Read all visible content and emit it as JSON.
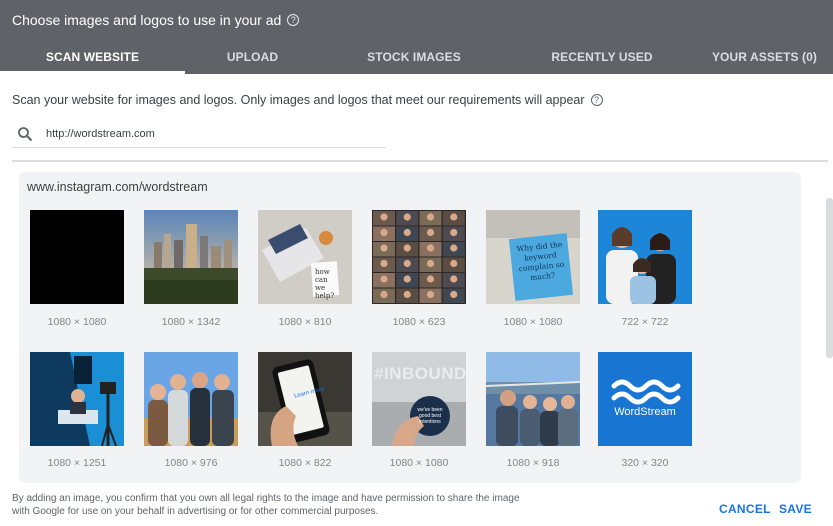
{
  "dialog": {
    "title": "Choose images and logos to use in your ad",
    "help_glyph": "?"
  },
  "tabs": [
    {
      "label": "SCAN WEBSITE",
      "active": true
    },
    {
      "label": "UPLOAD",
      "active": false
    },
    {
      "label": "STOCK IMAGES",
      "active": false
    },
    {
      "label": "RECENTLY USED",
      "active": false
    },
    {
      "label": "YOUR ASSETS (0)",
      "active": false
    }
  ],
  "scan": {
    "description": "Scan your website for images and logos. Only images and logos that meet our requirements will appear",
    "url_value": "http://wordstream.com",
    "search_icon": "search-icon"
  },
  "gallery": {
    "source_label": "www.instagram.com/wordstream",
    "images": [
      {
        "dims": "1080 × 1080",
        "subject": "black-square"
      },
      {
        "dims": "1080 × 1342",
        "subject": "city-skyline"
      },
      {
        "dims": "1080 × 810",
        "subject": "laptop-desk"
      },
      {
        "dims": "1080 × 623",
        "subject": "video-call-grid"
      },
      {
        "dims": "1080 × 1080",
        "subject": "sticky-note"
      },
      {
        "dims": "722 × 722",
        "subject": "three-women"
      },
      {
        "dims": "1080 × 1251",
        "subject": "studio-desk"
      },
      {
        "dims": "1080 × 976",
        "subject": "four-people"
      },
      {
        "dims": "1080 × 822",
        "subject": "phone-in-hand"
      },
      {
        "dims": "1080 × 1080",
        "subject": "inbound-sign"
      },
      {
        "dims": "1080 × 918",
        "subject": "group-bridge"
      },
      {
        "dims": "320 × 320",
        "subject": "wordstream-logo"
      }
    ],
    "sticky_note_text": "Why did the keyword complain so much?",
    "laptop_note_text": "how can we help?",
    "sign_text": "#INBOUND",
    "sign_sub": "we've been good best intentions",
    "logo_text": "WordStream",
    "phone_text": "Learn more"
  },
  "footer": {
    "legal_text": "By adding an image, you confirm that you own all legal rights to the image and have permission to share the image with Google for use on your behalf in advertising or for other commercial purposes.",
    "cancel_label": "CANCEL",
    "save_label": "SAVE"
  },
  "colors": {
    "header_bg": "#5f6368",
    "accent": "#1a73e8",
    "gallery_bg": "#f1f3f4",
    "logo_bg": "#1875d1"
  }
}
